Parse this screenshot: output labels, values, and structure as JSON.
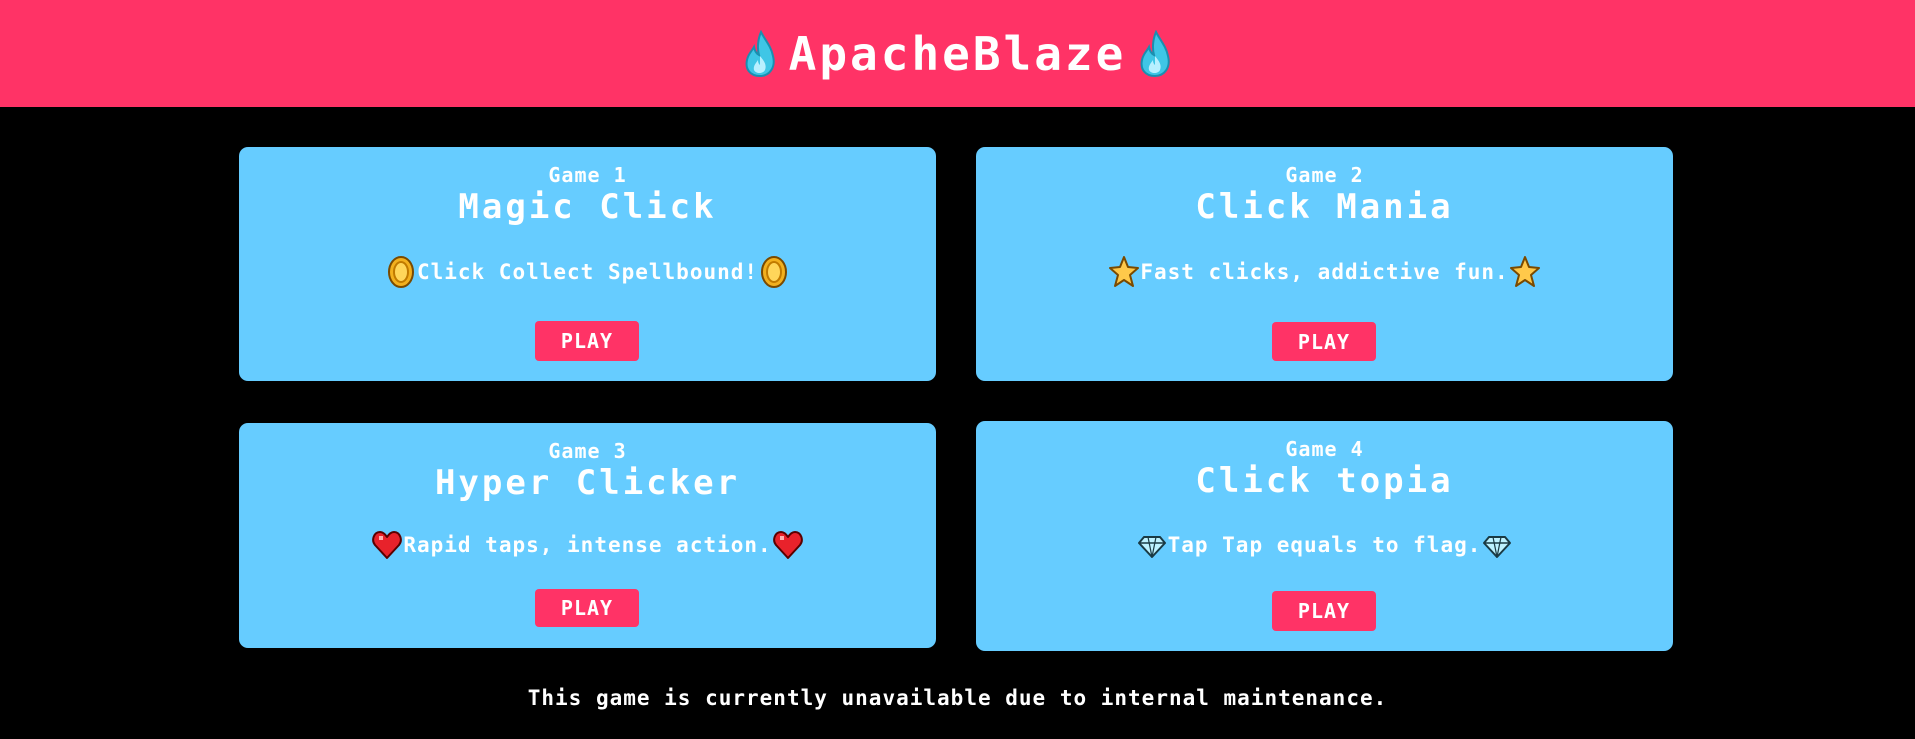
{
  "header": {
    "title": "ApacheBlaze",
    "left_icon": "blue-flame-icon",
    "right_icon": "blue-flame-icon"
  },
  "games": [
    {
      "label": "Game 1",
      "title": "Magic Click",
      "description": "Click Collect Spellbound!",
      "icon": "gold-coin-icon",
      "play_label": "PLAY"
    },
    {
      "label": "Game 2",
      "title": "Click Mania",
      "description": "Fast clicks, addictive fun.",
      "icon": "star-icon",
      "play_label": "PLAY"
    },
    {
      "label": "Game 3",
      "title": "Hyper Clicker",
      "description": "Rapid taps, intense action.",
      "icon": "heart-icon",
      "play_label": "PLAY"
    },
    {
      "label": "Game 4",
      "title": "Click topia",
      "description": "Tap Tap equals to flag.",
      "icon": "diamond-icon",
      "play_label": "PLAY"
    }
  ],
  "footer": {
    "notice": "This game is currently unavailable due to internal maintenance."
  },
  "colors": {
    "header_bg": "#ff3366",
    "page_bg": "#000000",
    "card_bg": "#66ccff",
    "button_bg": "#ff3366",
    "text": "#ffffff"
  }
}
